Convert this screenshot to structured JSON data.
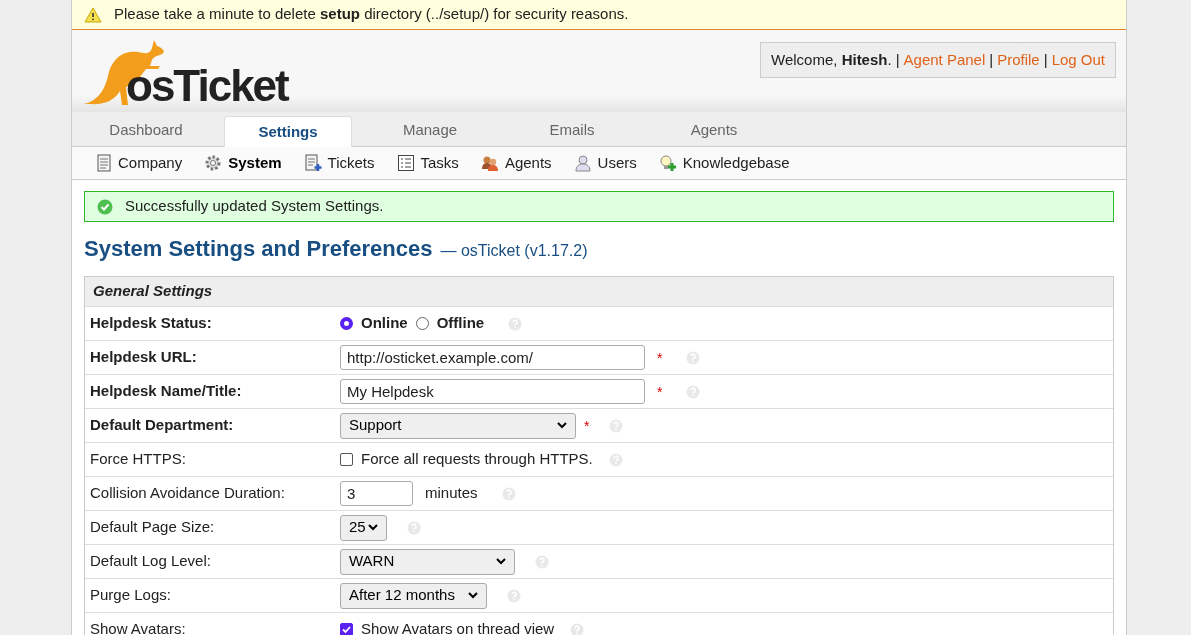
{
  "warning": {
    "text": "Please take a minute to delete **setup** directory (../setup/) for security reasons."
  },
  "logo": {
    "text": "osTicket"
  },
  "user_box": {
    "welcome": "Welcome, **Hitesh**.",
    "links": [
      {
        "separator": "|",
        "label": "Agent Panel"
      },
      {
        "separator": "|",
        "label": "Profile"
      },
      {
        "separator": "|",
        "label": "Log Out"
      }
    ]
  },
  "tabs": [
    {
      "label": "Dashboard",
      "selected": false
    },
    {
      "label": "Settings",
      "selected": true
    },
    {
      "label": "Manage",
      "selected": false
    },
    {
      "label": "Emails",
      "selected": false
    },
    {
      "label": "Agents",
      "selected": false
    }
  ],
  "subnav": [
    {
      "label": "Company",
      "selected": false
    },
    {
      "label": "System",
      "selected": true
    },
    {
      "label": "Tickets",
      "selected": false
    },
    {
      "label": "Tasks",
      "selected": false
    },
    {
      "label": "Agents",
      "selected": false
    },
    {
      "label": "Users",
      "selected": false
    },
    {
      "label": "Knowledgebase",
      "selected": false
    }
  ],
  "notice": {
    "text": "Successfully updated System Settings."
  },
  "heading": {
    "title": "System Settings and Preferences",
    "subtitle": "— osTicket (v1.17.2)"
  },
  "section": {
    "title": "General Settings",
    "rows": [
      {
        "kind": "radio",
        "label": "Helpdesk Status:",
        "bold": true,
        "options": [
          {
            "label": "Online",
            "selected": true
          },
          {
            "label": "Offline",
            "selected": false
          }
        ]
      },
      {
        "kind": "text",
        "label": "Helpdesk URL:",
        "bold": true,
        "value": "http://osticket.example.com/",
        "required_mark": "*"
      },
      {
        "kind": "text",
        "label": "Helpdesk Name/Title:",
        "bold": true,
        "value": "My Helpdesk",
        "required_mark": "*"
      },
      {
        "kind": "select",
        "label": "Default Department:",
        "bold": true,
        "value": "Support",
        "required_mark": "*"
      },
      {
        "kind": "checkbox",
        "label": "Force HTTPS:",
        "bold": false,
        "text": "Force all requests through HTTPS.",
        "checked": false
      },
      {
        "kind": "number",
        "label": "Collision Avoidance Duration:",
        "bold": false,
        "value": "3",
        "unit": "minutes"
      },
      {
        "kind": "select",
        "label": "Default Page Size:",
        "bold": false,
        "value": "25"
      },
      {
        "kind": "select",
        "label": "Default Log Level:",
        "bold": false,
        "value": "WARN"
      },
      {
        "kind": "select",
        "label": "Purge Logs:",
        "bold": false,
        "value": "After 12 months"
      },
      {
        "kind": "checkbox",
        "label": "Show Avatars:",
        "bold": false,
        "text": "Show Avatars on thread view",
        "checked": true
      }
    ]
  }
}
